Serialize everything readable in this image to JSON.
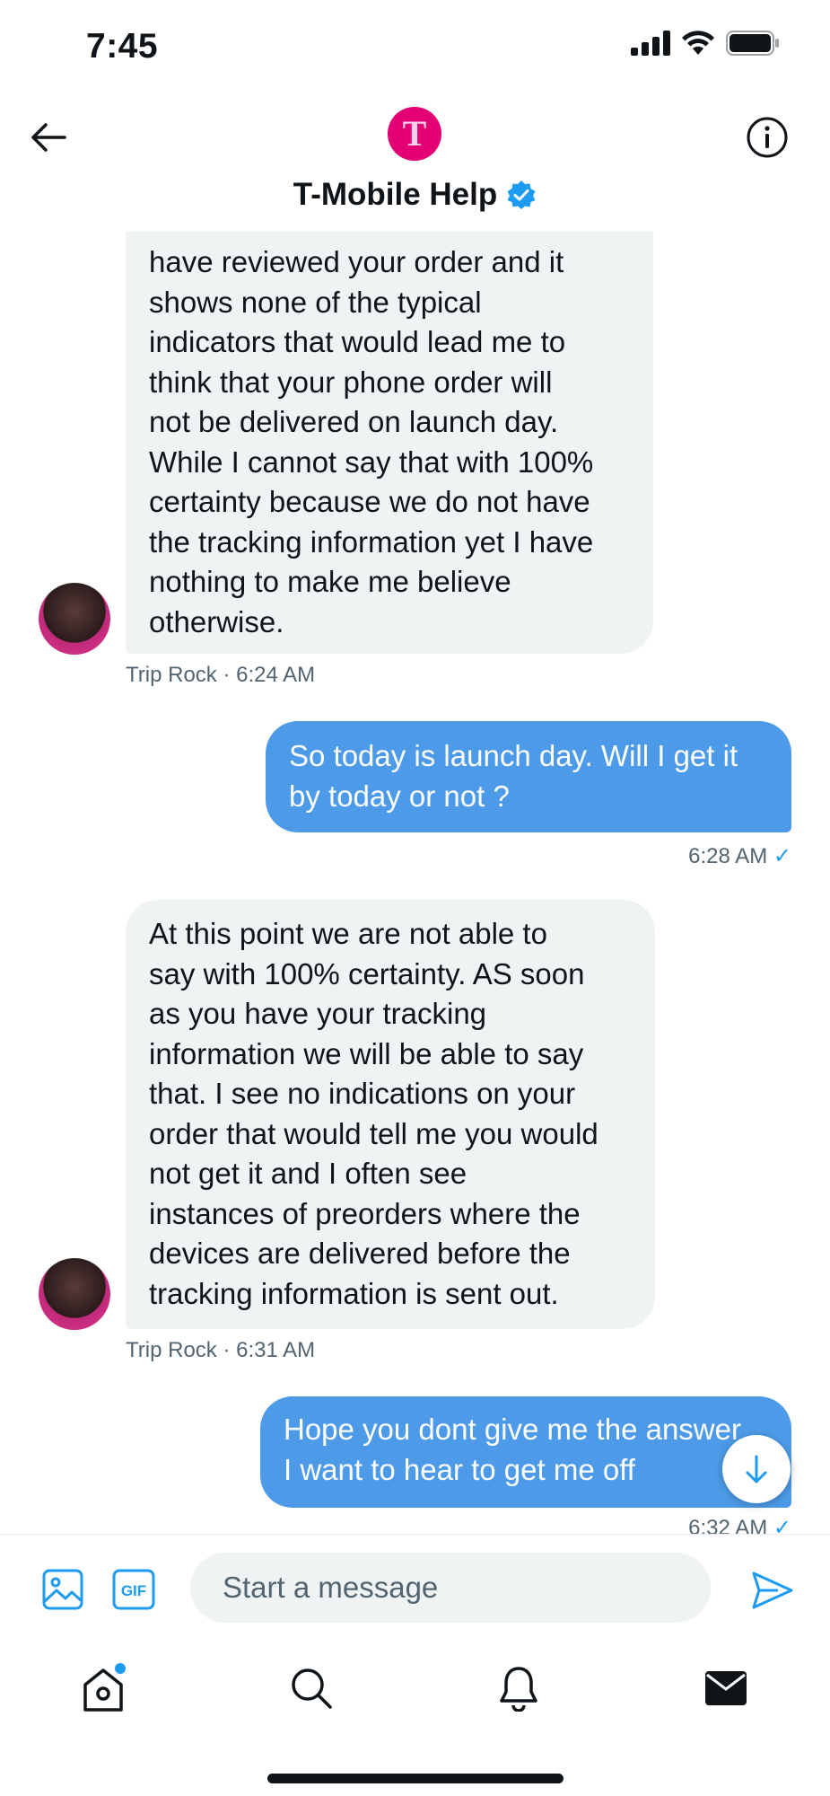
{
  "status_bar": {
    "time": "7:45"
  },
  "header": {
    "title": "T-Mobile Help",
    "avatar_letter": "T"
  },
  "messages": [
    {
      "direction": "in",
      "lines": [
        "have reviewed your order and it",
        "shows none of the typical",
        "indicators that would lead me to",
        "think that your phone order will",
        "not be delivered on launch day.",
        "While I cannot say that with 100%",
        "certainty because we do not have",
        "the tracking information yet I have",
        "nothing to make me believe",
        "otherwise."
      ],
      "meta": "Trip Rock · 6:24 AM"
    },
    {
      "direction": "out",
      "lines": [
        "So today is launch day. Will I get it",
        "by today or not ?"
      ],
      "meta": "6:28 AM"
    },
    {
      "direction": "in",
      "lines": [
        "At this point we are not able to",
        "say with 100% certainty. AS soon",
        "as you have your tracking",
        "information we will be able to say",
        "that. I see no indications on your",
        "order that would tell me you would",
        "not get it and I often see",
        "instances of preorders where the",
        "devices are delivered before the",
        "tracking information is sent out."
      ],
      "meta": "Trip Rock · 6:31 AM"
    },
    {
      "direction": "out",
      "lines": [
        "Hope you dont give me the answer",
        "I want to hear to get me off"
      ],
      "meta": "6:32 AM"
    }
  ],
  "read_check": "✓",
  "composer": {
    "placeholder": "Start a message",
    "gif_label": "GIF"
  },
  "icons": {
    "back": "back-arrow-icon",
    "info": "info-icon",
    "verified": "verified-badge-icon",
    "image": "image-icon",
    "gif": "gif-icon",
    "send": "send-icon",
    "home": "home-icon",
    "search": "search-icon",
    "notifications": "bell-icon",
    "messages": "mail-icon",
    "scroll_down": "arrow-down-icon"
  },
  "colors": {
    "accent": "#1d9bf0",
    "outgoing_bubble": "#4d9be8",
    "incoming_bubble": "#eff3f4",
    "brand_magenta": "#e20074"
  }
}
